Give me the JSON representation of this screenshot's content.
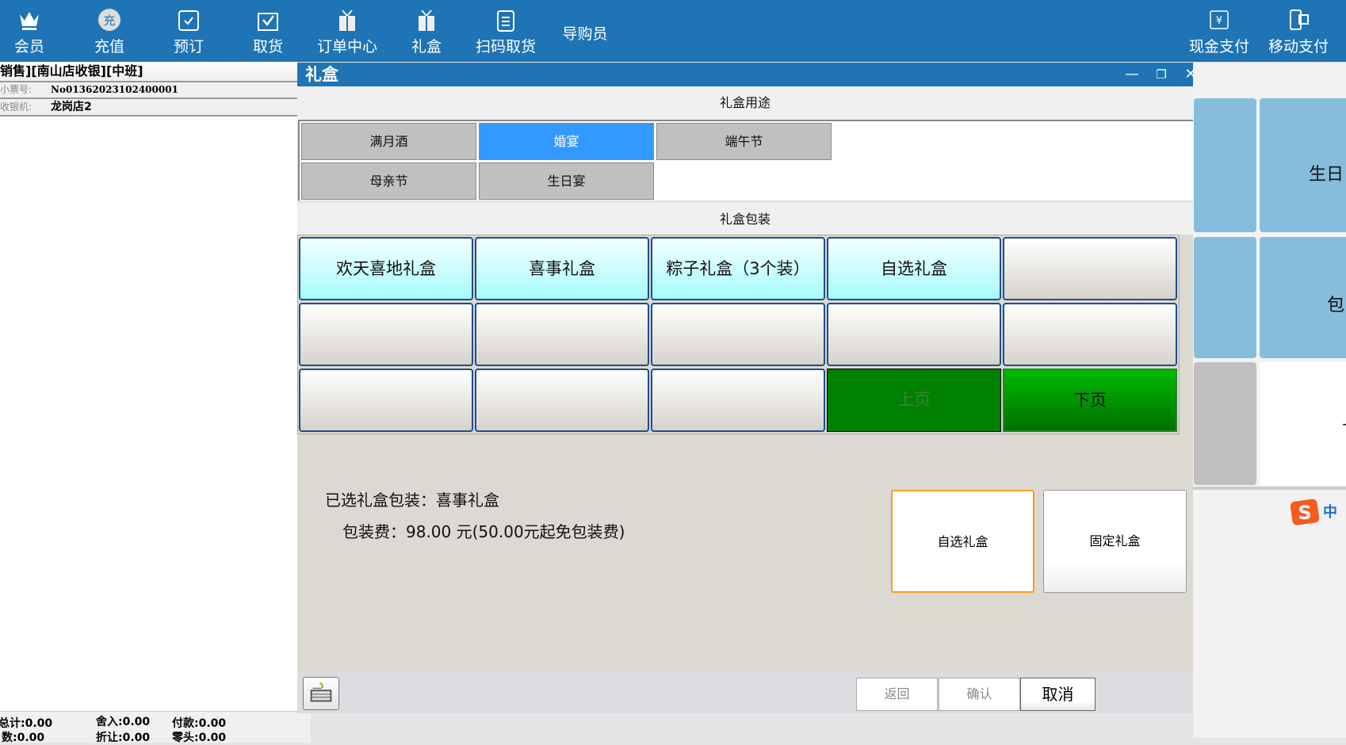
{
  "topbar": {
    "items": [
      {
        "label": "会员",
        "icon": "crown-icon"
      },
      {
        "label": "充值",
        "icon": "recharge-icon",
        "glyph": "充"
      },
      {
        "label": "预订",
        "icon": "calendar-check-icon"
      },
      {
        "label": "取货",
        "icon": "bag-check-icon"
      },
      {
        "label": "订单中心",
        "icon": "gift-icon"
      },
      {
        "label": "礼盒",
        "icon": "gift-icon"
      },
      {
        "label": "扫码取货",
        "icon": "clipboard-icon"
      },
      {
        "label": "导购员"
      }
    ],
    "right": [
      {
        "label": "现金支付",
        "icon": "cash-icon",
        "glyph": "¥"
      },
      {
        "label": "移动支付",
        "icon": "mobile-pay-icon"
      }
    ]
  },
  "left": {
    "header": "销售][南山店收银][中班]",
    "ticket_label": "小票号:",
    "ticket_value": "No01362023102400001",
    "register_label": "收银机:",
    "register_value": "龙岗店2",
    "totals": [
      "总计:0.00",
      "舍入:0.00",
      "付款:0.00",
      "数:0.00",
      "折让:0.00",
      "零头:0.00"
    ]
  },
  "dialog": {
    "title": "礼盒",
    "purpose_header": "礼盒用途",
    "purposes": [
      {
        "label": "满月酒",
        "selected": false
      },
      {
        "label": "婚宴",
        "selected": true
      },
      {
        "label": "端午节",
        "selected": false
      },
      {
        "label": "母亲节",
        "selected": false
      },
      {
        "label": "生日宴",
        "selected": false
      }
    ],
    "packaging_header": "礼盒包装",
    "packages": [
      "欢天喜地礼盒",
      "喜事礼盒",
      "粽子礼盒（3个装）",
      "自选礼盒",
      "",
      "",
      "",
      "",
      "",
      "",
      "",
      "",
      ""
    ],
    "prev_page": "上页",
    "next_page": "下页",
    "selected_text": "已选礼盒包装：喜事礼盒",
    "fee_text": "包装费：98.00 元(50.00元起免包装费)",
    "custom_box": "自选礼盒",
    "fixed_box": "固定礼盒",
    "back": "返回",
    "confirm": "确认",
    "cancel": "取消"
  },
  "background": {
    "tiles": [
      "生日",
      "包",
      "下"
    ]
  },
  "ime": {
    "label": "中"
  },
  "colors": {
    "brand": "#1e74b4",
    "selected": "#3399ff",
    "green": "#008000"
  }
}
